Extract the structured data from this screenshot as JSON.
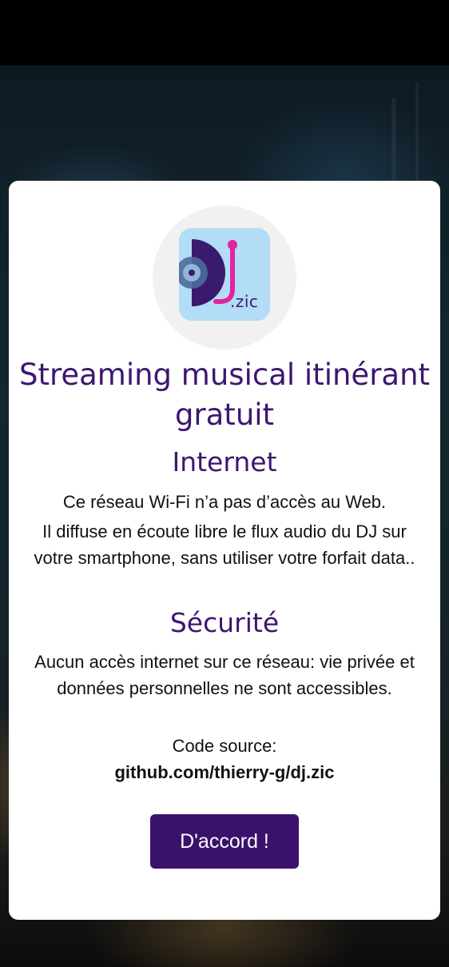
{
  "app": {
    "icon_text": ".zic",
    "brand_colors": {
      "primary": "#3d1670",
      "button": "#3a126b",
      "icon_background": "#b3dcf6",
      "icon_accent": "#e2259b"
    }
  },
  "dialog": {
    "title": "Streaming musical itinérant gratuit",
    "internet": {
      "heading": "Internet",
      "line1": "Ce réseau Wi-Fi n’a pas d’accès au Web.",
      "line2": "Il diffuse en écoute libre le flux audio du DJ sur votre smartphone, sans utiliser votre forfait data.."
    },
    "security": {
      "heading": "Sécurité",
      "line1": "Aucun accès internet sur ce réseau: vie privée et données personnelles ne sont accessibles.",
      "source_label": "Code source:",
      "source_link": "github.com/thierry-g/dj.zic"
    },
    "ok_button": "D'accord !"
  }
}
